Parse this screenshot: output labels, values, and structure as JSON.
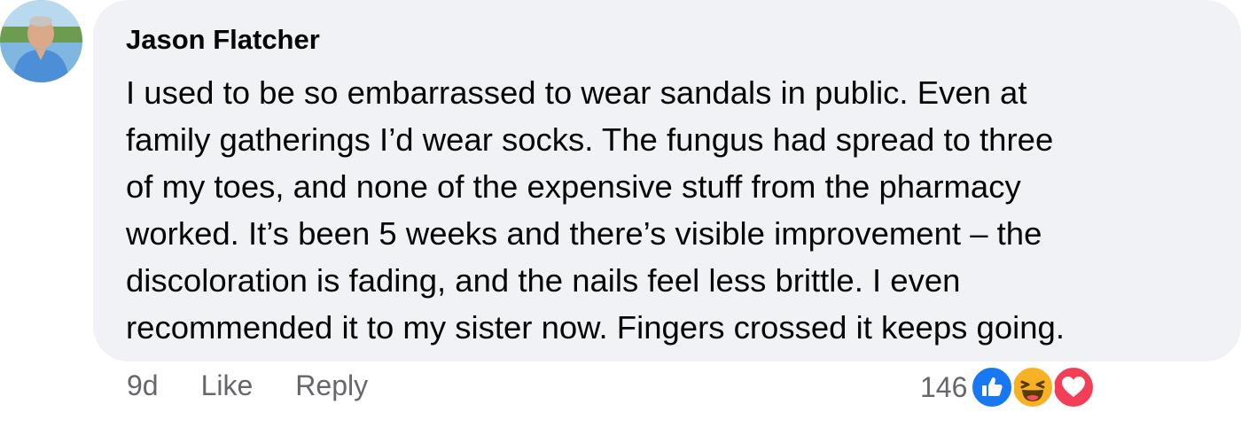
{
  "comment": {
    "author": "Jason Flatcher",
    "text_lines": [
      "I used to be so embarrassed to wear sandals in public. Even at",
      "family gatherings I’d wear socks. The fungus had spread to three",
      "of my toes, and none of the expensive stuff from the pharmacy",
      "worked. It’s been 5 weeks and there’s visible improvement – the",
      "discoloration is fading, and the nails feel less brittle. I even",
      "recommended it to my sister now. Fingers crossed it keeps going."
    ],
    "timestamp": "9d",
    "like_label": "Like",
    "reply_label": "Reply",
    "reaction_count": "146",
    "reactions": [
      "like-icon",
      "haha-icon",
      "love-icon"
    ]
  },
  "colors": {
    "bubble_bg": "#f0f2f5",
    "text": "#050505",
    "secondary_text": "#65676b",
    "like_blue": "#1877f2",
    "love_red": "#f33e58",
    "haha_yellow": "#f7b125"
  }
}
